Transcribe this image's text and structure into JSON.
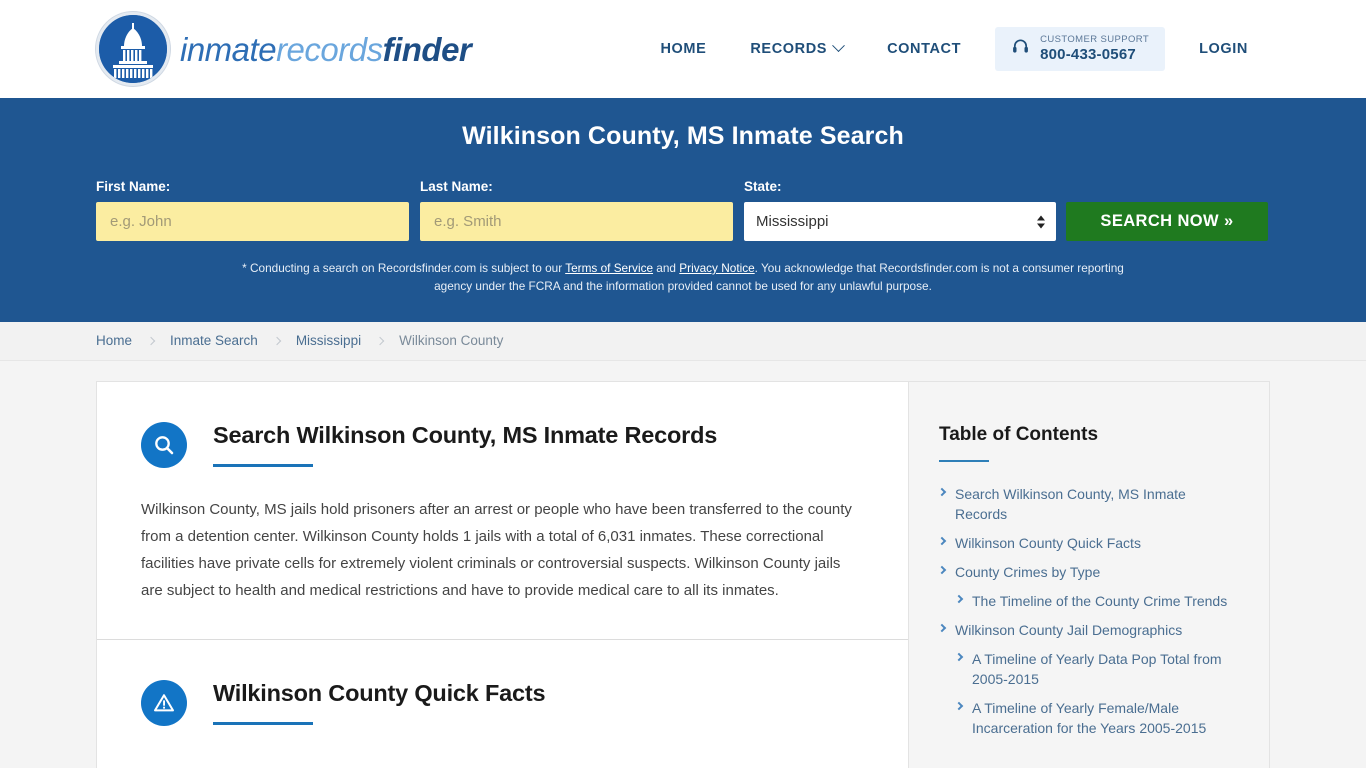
{
  "header": {
    "logo": {
      "icon": "capitol-dome-icon",
      "part1": "inmate",
      "part2": "records",
      "part3": "finder"
    },
    "nav": [
      {
        "label": "HOME",
        "name": "nav-home",
        "caret": false
      },
      {
        "label": "RECORDS",
        "name": "nav-records",
        "caret": true
      },
      {
        "label": "CONTACT",
        "name": "nav-contact",
        "caret": false
      }
    ],
    "support": {
      "icon": "headset-icon",
      "label": "CUSTOMER SUPPORT",
      "phone": "800-433-0567"
    },
    "login": "LOGIN"
  },
  "hero": {
    "title": "Wilkinson County, MS Inmate Search",
    "background_color": "#1f5691",
    "first_name": {
      "label": "First Name:",
      "placeholder": "e.g. John",
      "value": ""
    },
    "last_name": {
      "label": "Last Name:",
      "placeholder": "e.g. Smith",
      "value": ""
    },
    "state": {
      "label": "State:",
      "selected": "Mississippi"
    },
    "search_button": "SEARCH NOW »",
    "search_button_color": "#1f7a1f",
    "disclaimer": {
      "part1": "* Conducting a search on Recordsfinder.com is subject to our ",
      "link1": "Terms of Service",
      "part2": " and ",
      "link2": "Privacy Notice",
      "part3": ". You acknowledge that Recordsfinder.com is not a consumer reporting agency under the FCRA and the information provided cannot be used for any unlawful purpose."
    }
  },
  "breadcrumb": [
    {
      "label": "Home",
      "current": false
    },
    {
      "label": "Inmate Search",
      "current": false
    },
    {
      "label": "Mississippi",
      "current": false
    },
    {
      "label": "Wilkinson County",
      "current": true
    }
  ],
  "sections": [
    {
      "icon": "search-magnifier-icon",
      "title": "Search Wilkinson County, MS Inmate Records",
      "body": "Wilkinson County, MS jails hold prisoners after an arrest or people who have been transferred to the county from a detention center. Wilkinson County holds 1 jails with a total of 6,031 inmates. These correctional facilities have private cells for extremely violent criminals or controversial suspects. Wilkinson County jails are subject to health and medical restrictions and have to provide medical care to all its inmates."
    },
    {
      "icon": "warning-triangle-icon",
      "title": "Wilkinson County Quick Facts",
      "body": ""
    }
  ],
  "sidebar": {
    "title": "Table of Contents",
    "items": [
      {
        "label": "Search Wilkinson County, MS Inmate Records",
        "sub": false
      },
      {
        "label": "Wilkinson County Quick Facts",
        "sub": false
      },
      {
        "label": "County Crimes by Type",
        "sub": false
      },
      {
        "label": "The Timeline of the County Crime Trends",
        "sub": true
      },
      {
        "label": "Wilkinson County Jail Demographics",
        "sub": false
      },
      {
        "label": "A Timeline of Yearly Data Pop Total from 2005-2015",
        "sub": true
      },
      {
        "label": "A Timeline of Yearly Female/Male Incarceration for the Years 2005-2015",
        "sub": true
      }
    ]
  }
}
